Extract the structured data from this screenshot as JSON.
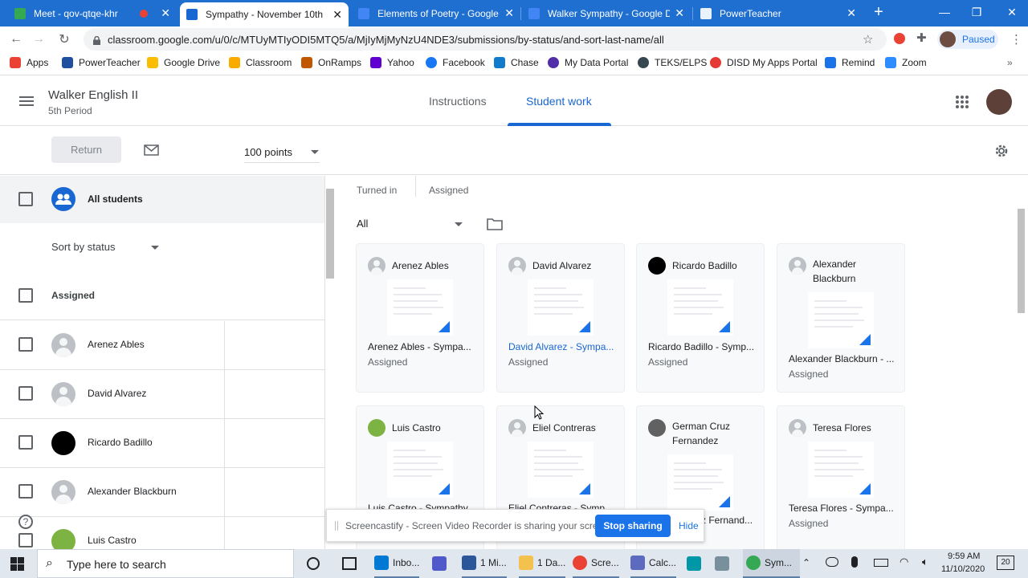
{
  "browser": {
    "tabs": [
      {
        "title": "Meet - qov-qtqe-khr",
        "color": "#34a853"
      },
      {
        "title": "Sympathy - November 10th",
        "color": "#1967d2"
      },
      {
        "title": "Elements of Poetry - Google D",
        "color": "#4285f4"
      },
      {
        "title": "Walker Sympathy - Google Do",
        "color": "#4285f4"
      },
      {
        "title": "PowerTeacher",
        "color": "#1f6fd1"
      }
    ],
    "new_tab": "+",
    "url": "classroom.google.com/u/0/c/MTUyMTIyODI5MTQ5/a/MjIyMjMyNzU4NDE3/submissions/by-status/and-sort-last-name/all",
    "profile_status": "Paused",
    "bookmarks": [
      {
        "label": "Apps",
        "color": "#ea4335"
      },
      {
        "label": "PowerTeacher",
        "color": "#1f4f9f"
      },
      {
        "label": "Google Drive",
        "color": "#fbbc04"
      },
      {
        "label": "Classroom",
        "color": "#f9ab00"
      },
      {
        "label": "OnRamps",
        "color": "#bf5700"
      },
      {
        "label": "Yahoo",
        "color": "#6001d2"
      },
      {
        "label": "Facebook",
        "color": "#1877f2"
      },
      {
        "label": "Chase",
        "color": "#117aca"
      },
      {
        "label": "My Data Portal",
        "color": "#512da8"
      },
      {
        "label": "TEKS/ELPS",
        "color": "#37474f"
      },
      {
        "label": "DISD My Apps Portal",
        "color": "#e53935"
      },
      {
        "label": "Remind",
        "color": "#1a73e8"
      },
      {
        "label": "Zoom",
        "color": "#2d8cff"
      }
    ]
  },
  "classroom": {
    "class_name": "Walker English II",
    "section": "5th Period",
    "tabs": [
      "Instructions",
      "Student work"
    ],
    "return_label": "Return",
    "points": "100 points",
    "all_students": "All students",
    "sort_label": "Sort by status",
    "group_label": "Assigned",
    "students": [
      {
        "name": "Arenez Ables",
        "avatar": "default"
      },
      {
        "name": "David Alvarez",
        "avatar": "default"
      },
      {
        "name": "Ricardo Badillo",
        "avatar": "black"
      },
      {
        "name": "Alexander Blackburn",
        "avatar": "default"
      },
      {
        "name": "Luis Castro",
        "avatar": "photo"
      }
    ],
    "stats": [
      {
        "label": "Turned in"
      },
      {
        "label": "Assigned"
      }
    ],
    "filter": "All",
    "cards": [
      {
        "name": "Arenez Ables",
        "file": "Arenez Ables - Sympa...",
        "status": "Assigned",
        "avatar": "default",
        "link": false
      },
      {
        "name": "David Alvarez",
        "file": "David Alvarez - Sympa...",
        "status": "Assigned",
        "avatar": "default",
        "link": true
      },
      {
        "name": "Ricardo Badillo",
        "file": "Ricardo Badillo - Symp...",
        "status": "Assigned",
        "avatar": "black",
        "link": false
      },
      {
        "name": "Alexander Blackburn",
        "file": "Alexander Blackburn - ...",
        "status": "Assigned",
        "avatar": "default",
        "link": false
      },
      {
        "name": "Luis Castro",
        "file": "Luis Castro - Sympathy",
        "status": "",
        "avatar": "photo",
        "link": false
      },
      {
        "name": "Eliel Contreras",
        "file": "Eliel Contreras - Symp",
        "status": "",
        "avatar": "default",
        "link": false
      },
      {
        "name": "German Cruz Fernandez",
        "file": "German Cruz Fernand...",
        "status": "",
        "avatar": "photo2",
        "link": false
      },
      {
        "name": "Teresa Flores",
        "file": "Teresa Flores - Sympa...",
        "status": "Assigned",
        "avatar": "default",
        "link": false
      }
    ]
  },
  "screencastify": {
    "message": "Screencastify - Screen Video Recorder is sharing your screen.",
    "stop_label": "Stop sharing",
    "hide_label": "Hide"
  },
  "taskbar": {
    "search_placeholder": "Type here to search",
    "apps": [
      {
        "label": "Inbo...",
        "color": "#0078d4"
      },
      {
        "label": "",
        "color": "#5059c9"
      },
      {
        "label": "1 Mi...",
        "color": "#2b579a"
      },
      {
        "label": "1 Da...",
        "color": "#f2c14e"
      },
      {
        "label": "Scre...",
        "color": "#ea4335"
      },
      {
        "label": "Calc...",
        "color": "#5c6bc0"
      },
      {
        "label": "",
        "color": "#0097a7"
      },
      {
        "label": "",
        "color": "#78909c"
      },
      {
        "label": "Sym...",
        "color": "#34a853"
      }
    ],
    "time": "9:59 AM",
    "date": "11/10/2020",
    "notifications": "20"
  }
}
